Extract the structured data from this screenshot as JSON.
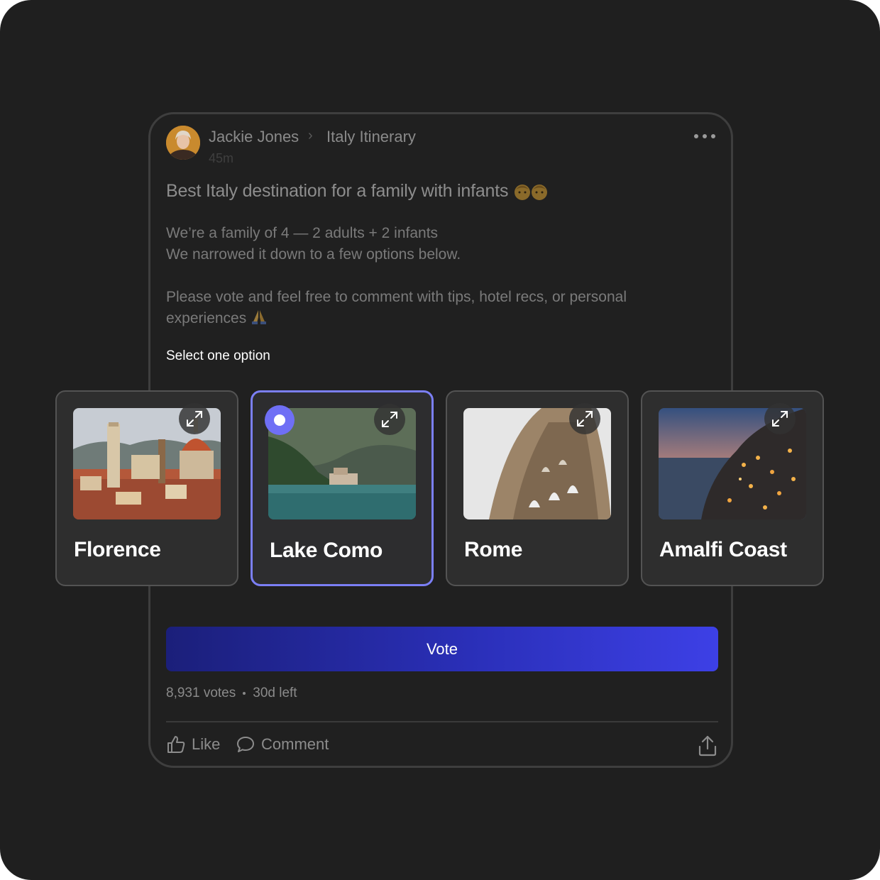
{
  "post": {
    "author": "Jackie Jones",
    "group": "Italy Itinerary",
    "time_ago": "45m",
    "title": "Best Italy destination for a family with infants",
    "title_emoji": "infant-faces-emoji",
    "body_line1": "We’re a family of 4 — 2 adults + 2 infants",
    "body_line2": "We narrowed it down to a few options below.",
    "body_line3": "Please vote and feel free to comment with tips, hotel recs, or personal experiences",
    "body_emoji": "praying-hands-emoji"
  },
  "poll": {
    "instruction": "Select one option",
    "selected_option": "Lake Como",
    "options": [
      {
        "label": "Florence"
      },
      {
        "label": "Lake Como"
      },
      {
        "label": "Rome"
      },
      {
        "label": "Amalfi Coast"
      }
    ],
    "vote_label": "Vote",
    "votes": "8,931 votes",
    "time_left": "30d left"
  },
  "actions": {
    "like_label": "Like",
    "comment_label": "Comment"
  },
  "colors": {
    "background": "#1f1f1f",
    "card_border": "#3e3e3e",
    "accent": "#6f6ff5",
    "vote_gradient_start": "#1b1f7a",
    "vote_gradient_end": "#3d40e6"
  }
}
